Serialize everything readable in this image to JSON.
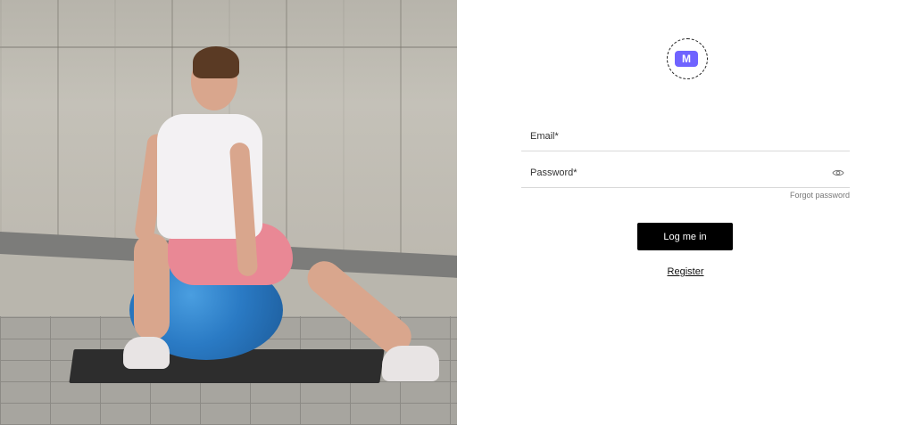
{
  "hero": {
    "image_alt": "woman-on-exercise-ball"
  },
  "brand": {
    "logo_text": "M",
    "logo_color": "#6f63ff"
  },
  "form": {
    "email": {
      "label": "Email*",
      "value": ""
    },
    "password": {
      "label": "Password*",
      "value": ""
    },
    "forgot_password": "Forgot password",
    "login_button": "Log me in",
    "register_link": "Register"
  },
  "colors": {
    "button_bg": "#000000",
    "button_text": "#ffffff",
    "accent": "#6f63ff"
  }
}
